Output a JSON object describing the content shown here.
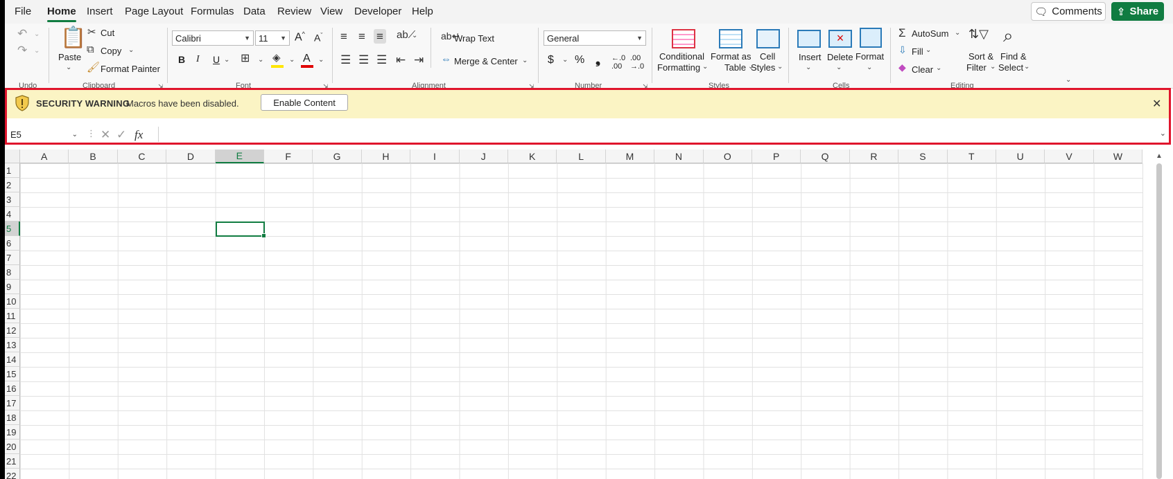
{
  "menu": {
    "items": [
      "File",
      "Home",
      "Insert",
      "Page Layout",
      "Formulas",
      "Data",
      "Review",
      "View",
      "Developer",
      "Help"
    ],
    "active": "Home",
    "comments_label": "Comments",
    "share_label": "Share"
  },
  "ribbon": {
    "clipboard": {
      "paste": "Paste",
      "cut": "Cut",
      "copy": "Copy",
      "format_painter": "Format Painter",
      "group_label": "Clipboard"
    },
    "undo_group_label": "Undo",
    "font": {
      "name": "Calibri",
      "size": "11",
      "bold": "B",
      "italic": "I",
      "underline": "U",
      "group_label": "Font"
    },
    "alignment": {
      "wrap_text": "Wrap Text",
      "merge_center": "Merge & Center",
      "group_label": "Alignment"
    },
    "number": {
      "format": "General",
      "currency": "$",
      "percent": "%",
      "comma": "❟",
      "group_label": "Number"
    },
    "styles": {
      "conditional_1": "Conditional",
      "conditional_2": "Formatting",
      "format_table_1": "Format as",
      "format_table_2": "Table",
      "cell_styles_1": "Cell",
      "cell_styles_2": "Styles",
      "group_label": "Styles"
    },
    "cells": {
      "insert": "Insert",
      "delete": "Delete",
      "format": "Format",
      "group_label": "Cells"
    },
    "editing": {
      "autosum": "AutoSum",
      "fill": "Fill",
      "clear": "Clear",
      "sort_1": "Sort &",
      "sort_2": "Filter",
      "find_1": "Find &",
      "find_2": "Select",
      "group_label": "Editing"
    }
  },
  "security_bar": {
    "title": "SECURITY WARNING",
    "message": "Macros have been disabled.",
    "button": "Enable Content"
  },
  "formula_bar": {
    "name_box": "E5",
    "fx_label": "fx",
    "formula": ""
  },
  "grid": {
    "columns": [
      "A",
      "B",
      "C",
      "D",
      "E",
      "F",
      "G",
      "H",
      "I",
      "J",
      "K",
      "L",
      "M",
      "N",
      "O",
      "P",
      "Q",
      "R",
      "S",
      "T",
      "U",
      "V",
      "W"
    ],
    "rows": [
      "1",
      "2",
      "3",
      "4",
      "5",
      "6",
      "7",
      "8",
      "9",
      "10",
      "11",
      "12",
      "13",
      "14",
      "15",
      "16",
      "17",
      "18",
      "19",
      "20",
      "21",
      "22"
    ],
    "selected_column": "E",
    "selected_row": "5"
  },
  "colors": {
    "accent": "#107c41",
    "warning_bg": "#fbf4c4",
    "highlight_border": "#e0152c"
  }
}
